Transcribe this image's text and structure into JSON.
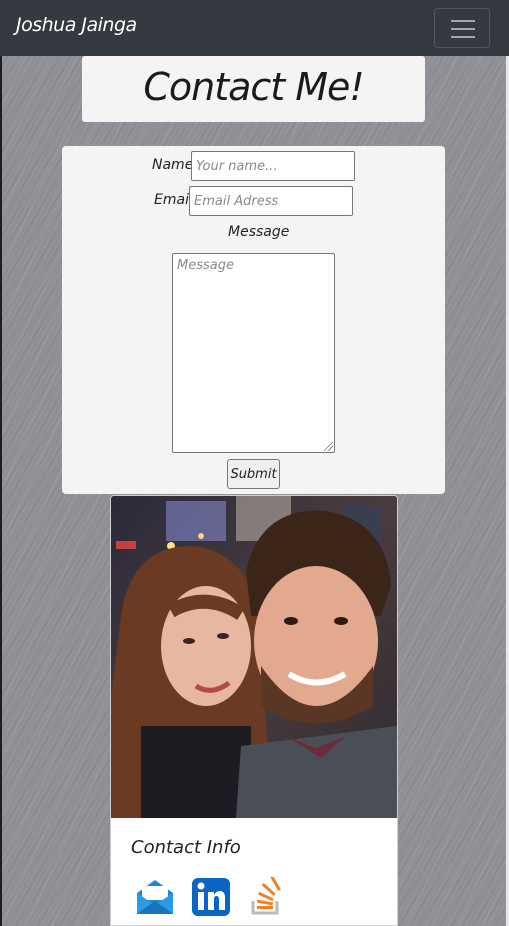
{
  "navbar": {
    "brand": "Joshua Jainga",
    "toggle_icon": "hamburger-icon"
  },
  "header": {
    "title": "Contact Me!"
  },
  "form": {
    "name_label": "Name",
    "name_placeholder": "Your name...",
    "email_label": "Email",
    "email_placeholder": "Email Adress",
    "message_label": "Message",
    "message_placeholder": "Message",
    "submit_label": "Submit"
  },
  "profile": {
    "photo": "couple-selfie-photo",
    "contact_title": "Contact Info",
    "links": [
      {
        "icon": "email-icon"
      },
      {
        "icon": "linkedin-icon"
      },
      {
        "icon": "stackoverflow-icon"
      }
    ]
  },
  "colors": {
    "navbar_bg": "#343a40",
    "card_bg": "#f4f4f4",
    "email_blue": "#1e88d4",
    "linkedin_blue": "#0a66c2",
    "stackoverflow_orange": "#f48024"
  }
}
